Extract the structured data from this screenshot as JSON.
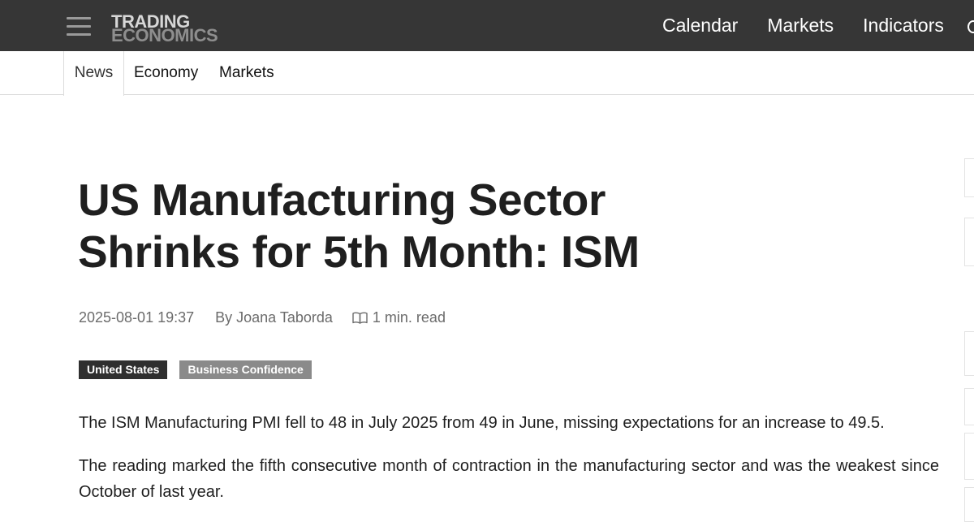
{
  "header": {
    "logo": {
      "line1": "TRADING",
      "line2": "ECONOMICS"
    },
    "nav": [
      "Calendar",
      "Markets",
      "Indicators"
    ]
  },
  "subnav": {
    "tabs": [
      "News",
      "Economy",
      "Markets"
    ],
    "active_tab": "News"
  },
  "article": {
    "headline": "US Manufacturing Sector Shrinks for 5th Month: ISM",
    "date": "2025-08-01 19:37",
    "author": "By Joana Taborda",
    "read_time": "1 min. read",
    "tags": [
      "United States",
      "Business Confidence"
    ],
    "paragraphs": [
      "The ISM Manufacturing PMI fell to 48 in July 2025 from 49 in June, missing expectations for an increase to 49.5.",
      "The reading marked the fifth consecutive month of contraction in the manufacturing sector and was the weakest since October of last year."
    ]
  },
  "icons": {
    "menu": "hamburger-menu-icon",
    "read_time": "open-book-icon",
    "more": "circle-icon"
  },
  "colors": {
    "topbar_bg": "#363636",
    "tag_country_bg": "#2f2f2f",
    "tag_category_bg": "#8a8a8a"
  }
}
